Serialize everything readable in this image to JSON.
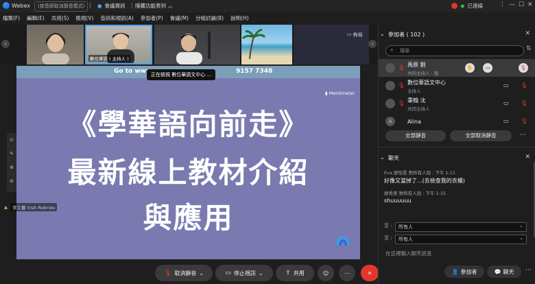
{
  "titlebar": {
    "app_name": "Webex",
    "record_badge": "(按音即取消靜音模式)",
    "meeting_info": "會議資訊",
    "hide_menu": "隱藏功能表列",
    "conn_status": "已連線"
  },
  "menubar": {
    "items": [
      "檔案(F)",
      "編輯(E)",
      "共用(S)",
      "檢視(V)",
      "音訊和視訊(A)",
      "參加者(P)",
      "會議(M)",
      "分組討論(B)",
      "說明(H)"
    ]
  },
  "video_strip": {
    "tiles": [
      {
        "caption": ""
      },
      {
        "caption": "數位華語 ( 主持人 )"
      },
      {
        "caption": ""
      },
      {
        "caption": ""
      },
      {
        "caption": ""
      }
    ],
    "layout_label": "佈局"
  },
  "share": {
    "goto_text": "Go to www.",
    "goto_code": "9157 7348",
    "tip": "正在檢視 數位華語文中心 ...",
    "mentimeter": "Mentimeter",
    "slide_line1": "《學華語向前走》",
    "slide_line2": "最新線上教材介紹",
    "slide_line3": "與應用"
  },
  "nametag": "李又蔓 Irish Robrido",
  "controls": {
    "unmute": "取消靜音",
    "stop_video": "停止視訊",
    "share": "共用"
  },
  "participants": {
    "header": "參加者 ( 102 )",
    "search_placeholder": "搜尋",
    "list": [
      {
        "initial": "",
        "name": "禹辰 劉",
        "role": "共同主持人 · 我"
      },
      {
        "initial": "",
        "name": "數位華語文中心",
        "role": "主持人"
      },
      {
        "initial": "",
        "name": "秉翰 沈",
        "role": "共同主持人"
      },
      {
        "initial": "A",
        "name": "Alina",
        "role": ""
      }
    ],
    "mute_all": "全部靜音",
    "unmute_all": "全部取消靜音"
  },
  "chat": {
    "header": "聊天",
    "messages": [
      {
        "from": "Eva 廖怡雯 對所有人說 :   下午 1:11",
        "text": "好像又當掉了...(去檢查我的衣櫃)"
      },
      {
        "from": "廖秀美 對所有人說 :   下午 1:15",
        "text": "shuuuuuu"
      }
    ],
    "to_label1": "至 :",
    "to_value1": "所有人",
    "to_label2": "至 :",
    "to_value2": "所有人",
    "input_placeholder": "在這裡輸入聊天訊息"
  },
  "bottom_right": {
    "participants_btn": "參加者",
    "chat_btn": "聊天"
  },
  "colors": {
    "slide_bg": "#7a7ab0",
    "end_red": "#e2362c"
  }
}
